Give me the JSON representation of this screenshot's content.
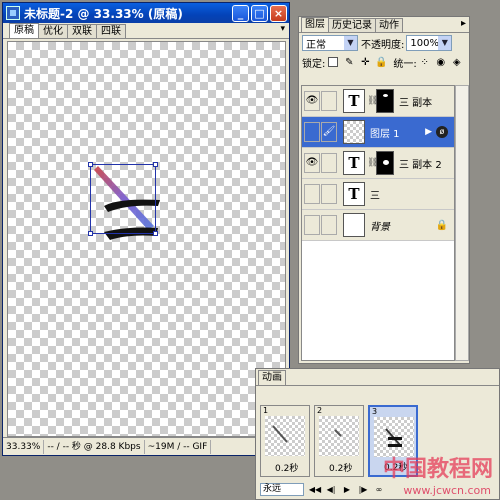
{
  "document": {
    "title": "未标题-2 @ 33.33% (原稿)",
    "window_buttons": {
      "minimize": "_",
      "maximize": "□",
      "close": "×"
    },
    "view_tabs": [
      "原稿",
      "优化",
      "双联",
      "四联"
    ],
    "status": {
      "zoom": "33.33%",
      "speed": "-- / -- 秒 @ 28.8 Kbps",
      "size": "~19M / -- GIF"
    }
  },
  "layers_panel": {
    "tabs": [
      "图层",
      "历史记录",
      "动作"
    ],
    "blend_mode": "正常",
    "opacity_label": "不透明度:",
    "opacity_value": "100%",
    "lock_label": "锁定:",
    "unify_label": "统一:",
    "layers": [
      {
        "name": "三 副本",
        "type": "text",
        "thumb_text": "T",
        "visible": true,
        "active": false
      },
      {
        "name": "图层 1",
        "type": "pixel",
        "thumb_text": "",
        "visible": false,
        "active": true,
        "has_fx": true
      },
      {
        "name": "三 副本 2",
        "type": "text",
        "thumb_text": "T",
        "visible": true,
        "active": false
      },
      {
        "name": "三",
        "type": "text",
        "thumb_text": "T",
        "visible": false,
        "active": false
      },
      {
        "name": "背景",
        "type": "background",
        "thumb_text": "",
        "visible": false,
        "active": false,
        "locked": true
      }
    ]
  },
  "animation_panel": {
    "tab": "动画",
    "frames": [
      {
        "number": "1",
        "delay": "0.2秒"
      },
      {
        "number": "2",
        "delay": "0.2秒"
      },
      {
        "number": "3",
        "delay": "0.2秒"
      }
    ],
    "loop": "永远"
  },
  "watermark": {
    "text": "中国教程网",
    "url": "www.jcwcn.com"
  },
  "colors": {
    "accent": "#3a6ad0",
    "titlebar": "#0443b8"
  }
}
